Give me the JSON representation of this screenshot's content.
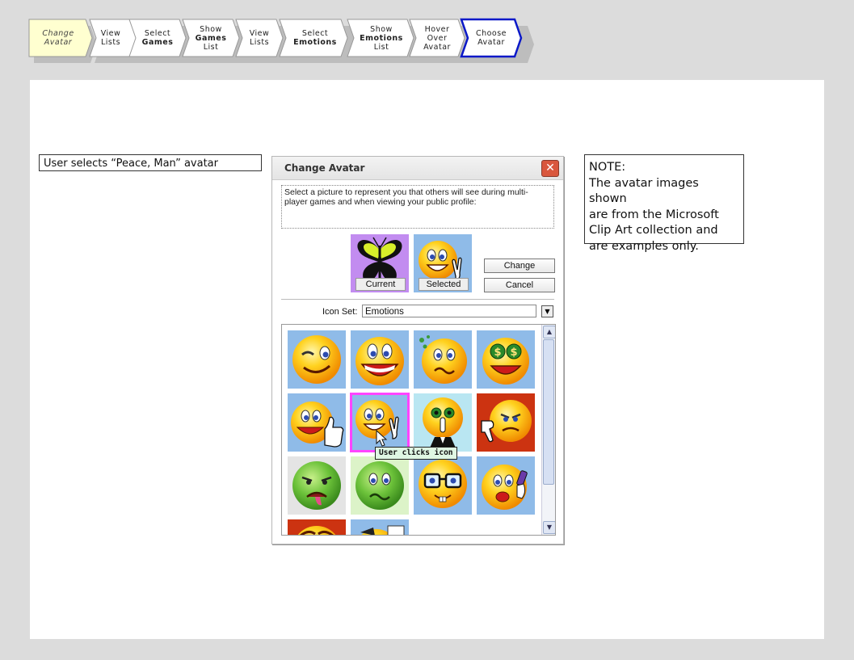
{
  "flow": {
    "steps": [
      {
        "line1": "Change",
        "line2": "Avatar",
        "line3": ""
      },
      {
        "line1": "View",
        "line2": "Lists",
        "line3": ""
      },
      {
        "line1": "Select",
        "line2": "Games",
        "line3": ""
      },
      {
        "line1": "Show",
        "line2": "Games",
        "line3": "List"
      },
      {
        "line1": "View",
        "line2": "Lists",
        "line3": ""
      },
      {
        "line1": "Select",
        "line2": "Emotions",
        "line3": ""
      },
      {
        "line1": "Show",
        "line2": "Emotions",
        "line3": "List"
      },
      {
        "line1": "Hover",
        "line2": "Over",
        "line3": "Avatar"
      },
      {
        "line1": "Choose",
        "line2": "Avatar",
        "line3": ""
      }
    ]
  },
  "caption": "User selects “Peace, Man” avatar",
  "note": {
    "lines": [
      "NOTE:",
      "The avatar images shown",
      "are from the Microsoft",
      "Clip Art collection and",
      "are examples only."
    ]
  },
  "dialog": {
    "title": "Change Avatar",
    "close_label": "✕",
    "instructions": "Select a picture to represent you that others will see during multi-player games and when viewing your public profile:",
    "current_label": "Current",
    "selected_label": "Selected",
    "change_button": "Change",
    "cancel_button": "Cancel",
    "icon_set_label": "Icon Set:",
    "icon_set_value": "Emotions",
    "tooltip": "User clicks icon"
  },
  "colors": {
    "selected_border": "#ff44ff",
    "active_step_border": "#0a18c8",
    "first_step_fill": "#ffffd0",
    "tile_blue": "#8fbbe8",
    "tile_red": "#cc3311"
  }
}
